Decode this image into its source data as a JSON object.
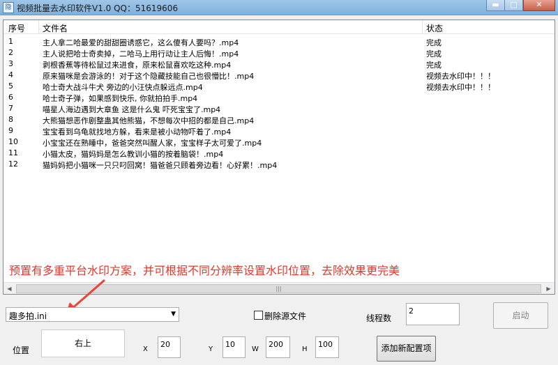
{
  "window": {
    "title": "视频批量去水印软件V1.0 QQ：51619606",
    "icon_text": "隐",
    "minimize_glyph": "▬",
    "maximize_glyph": "□",
    "close_glyph": "✕"
  },
  "list": {
    "columns": {
      "index": "序号",
      "name": "文件名",
      "status": "状态"
    },
    "rows": [
      {
        "idx": "1",
        "name": "主人拿二哈最爱的甜甜圈诱惑它，这么傻有人要吗？.mp4",
        "status": "完成"
      },
      {
        "idx": "2",
        "name": "主人说把哈士奇卖掉，二哈马上用行动让主人后悔！.mp4",
        "status": "完成"
      },
      {
        "idx": "3",
        "name": "剥根香蕉等待松鼠过来进食，原来松鼠喜欢吃这种.mp4",
        "status": "完成"
      },
      {
        "idx": "4",
        "name": "原来猫咪是会游泳的！对于这个隐藏技能自己也很懵比！.mp4",
        "status": "视频去水印中！！！"
      },
      {
        "idx": "5",
        "name": "哈士奇大战斗牛犬 旁边的小汪快点躲远点.mp4",
        "status": "视频去水印中！！！"
      },
      {
        "idx": "6",
        "name": "哈士奇子弹，如果感到快乐, 你就拍拍手.mp4",
        "status": ""
      },
      {
        "idx": "7",
        "name": "喵星人海边遇到大章鱼 这是什么鬼 吓死宝宝了.mp4",
        "status": ""
      },
      {
        "idx": "8",
        "name": "大熊猫想恶作剧整蛊其他熊猫，不想每次中招的都是自己.mp4",
        "status": ""
      },
      {
        "idx": "9",
        "name": "宝宝看到乌龟就找地方躲，看来是被小动物吓着了.mp4",
        "status": ""
      },
      {
        "idx": "10",
        "name": "小宝宝还在熟睡中，爸爸突然叫醒人家，宝宝样子太可爱了.mp4",
        "status": ""
      },
      {
        "idx": "11",
        "name": "小猫太皮，猫妈妈是怎么教训小猫的按着脑袋！.mp4",
        "status": ""
      },
      {
        "idx": "12",
        "name": "猫妈妈把小猫咪一只只叼回窝！猫爸爸只顾着旁边看！心好累！.mp4",
        "status": ""
      }
    ],
    "promo_text": "预置有多重平台水印方案，并可根据不同分辨率设置水印位置，去除效果更完美",
    "scroll_left": "◀",
    "scroll_right": "▶",
    "scroll_grip": "|||"
  },
  "controls": {
    "preset_value": "趣多拍.ini",
    "dropdown_arrow": "▼",
    "delete_source_label": "删除源文件",
    "delete_source_checked": false,
    "threads_label": "线程数",
    "threads_value": "2",
    "start_label": "启动",
    "position_label": "位置",
    "position_value": "右上",
    "x_label": "X",
    "x_value": "20",
    "y_label": "Y",
    "y_value": "10",
    "w_label": "W",
    "w_value": "200",
    "h_label": "H",
    "h_value": "100",
    "add_preset_label": "添加新配置项"
  },
  "colors": {
    "promo": "#e0372a",
    "arrow": "#e8443a"
  }
}
